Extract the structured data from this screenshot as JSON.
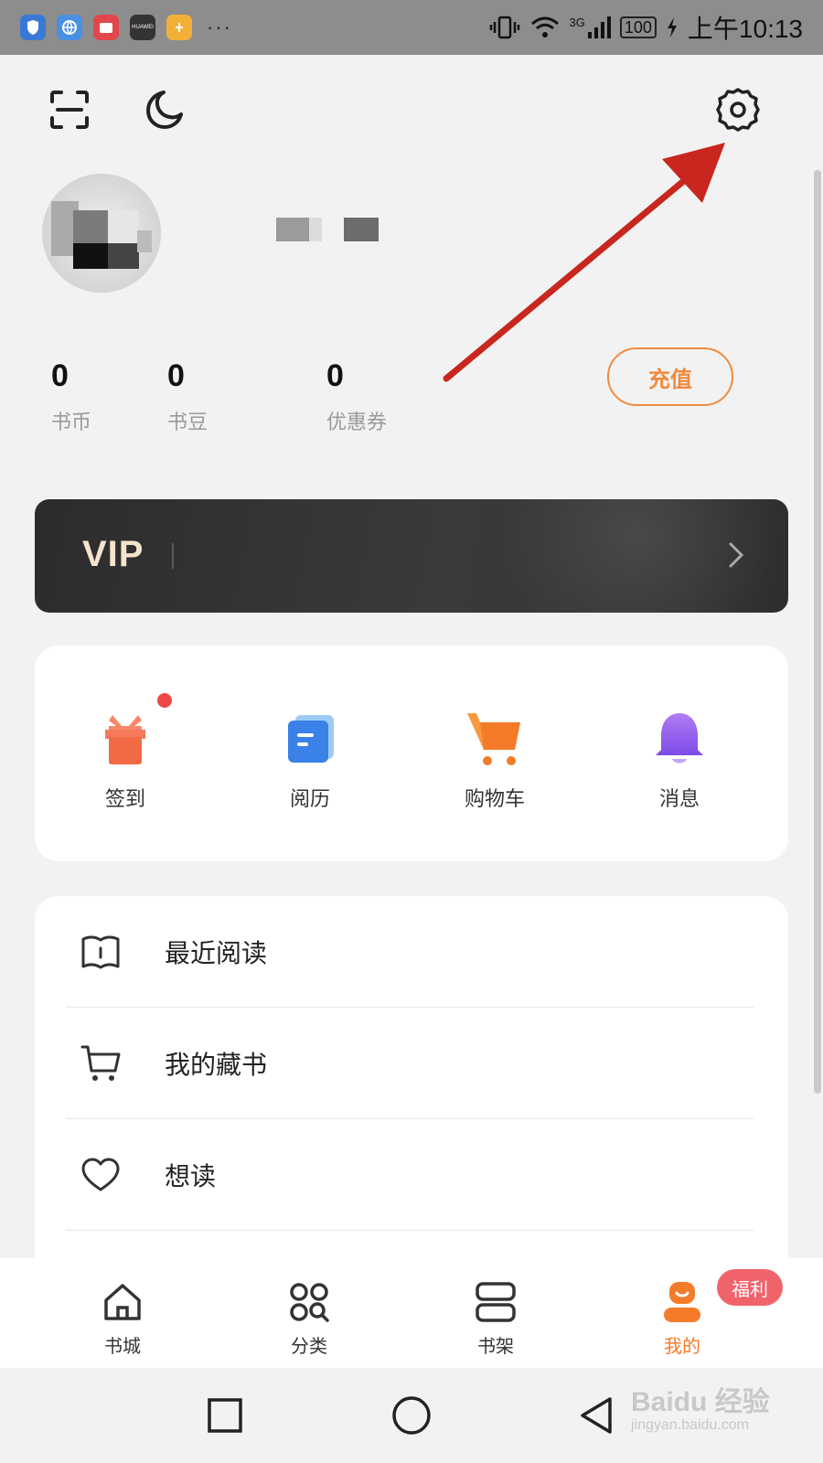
{
  "status_bar": {
    "apps": [
      "shield-app-icon",
      "browser-app-icon",
      "red-app-icon",
      "huawei-app-icon",
      "yellow-app-icon"
    ],
    "huawei_label": "HUAWEI",
    "more": "···",
    "network": "3G",
    "battery": "100",
    "time": "上午10:13"
  },
  "profile": {
    "stats": [
      {
        "value": "0",
        "label": "书币"
      },
      {
        "value": "0",
        "label": "书豆"
      },
      {
        "value": "0",
        "label": "优惠券"
      }
    ],
    "recharge_label": "充值"
  },
  "vip": {
    "label": "VIP"
  },
  "quick_actions": [
    {
      "label": "签到",
      "icon": "gift-icon",
      "has_dot": true
    },
    {
      "label": "阅历",
      "icon": "reading-history-icon"
    },
    {
      "label": "购物车",
      "icon": "shopping-cart-icon"
    },
    {
      "label": "消息",
      "icon": "bell-icon"
    }
  ],
  "menu": [
    {
      "label": "最近阅读",
      "icon": "book-open-icon"
    },
    {
      "label": "我的藏书",
      "icon": "cart-outline-icon"
    },
    {
      "label": "想读",
      "icon": "heart-icon"
    }
  ],
  "tabs": [
    {
      "label": "书城",
      "icon": "home-icon"
    },
    {
      "label": "分类",
      "icon": "grid-search-icon"
    },
    {
      "label": "书架",
      "icon": "bookshelf-icon"
    },
    {
      "label": "我的",
      "icon": "profile-icon",
      "active": true
    }
  ],
  "tab_badge": "福利",
  "watermark": {
    "brand": "Baidu 经验",
    "url": "jingyan.baidu.com"
  },
  "colors": {
    "accent": "#f47b2a",
    "vip_bg": "#2c2c2c",
    "annotation": "#c8261e",
    "badge": "#f0636b"
  }
}
